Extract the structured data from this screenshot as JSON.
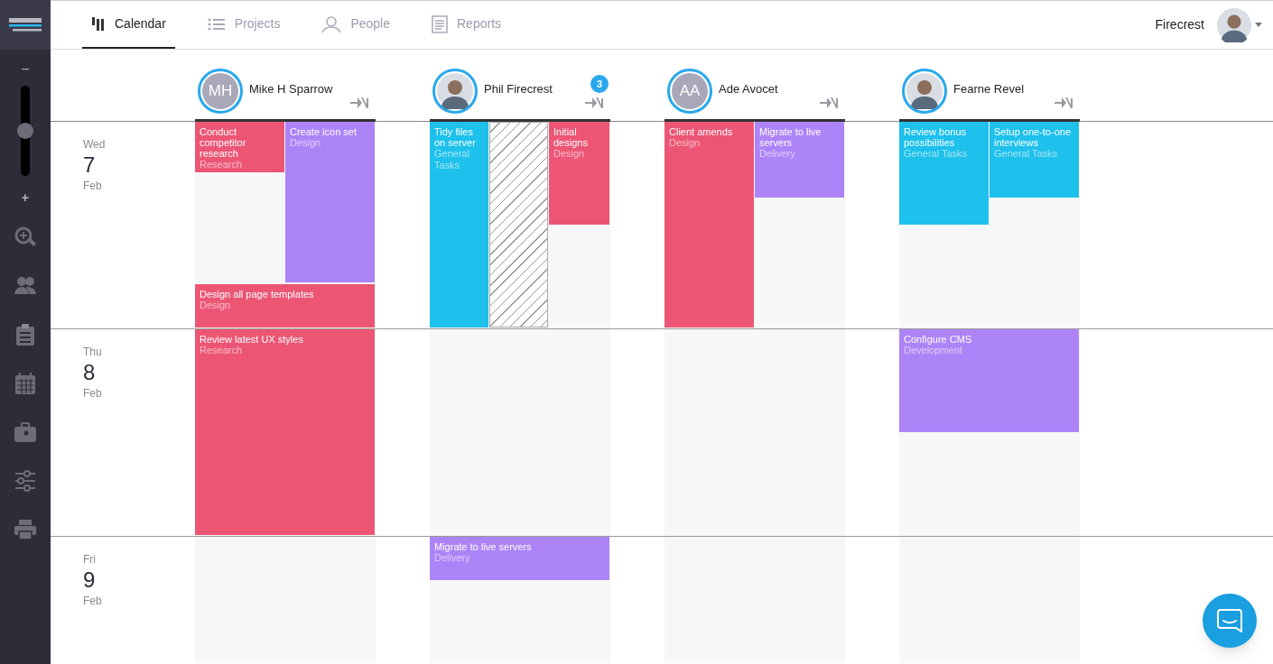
{
  "nav": {
    "tabs": [
      {
        "label": "Calendar",
        "kind": "calendar",
        "selected": true
      },
      {
        "label": "Projects",
        "kind": "projects",
        "selected": false
      },
      {
        "label": "People",
        "kind": "people",
        "selected": false
      },
      {
        "label": "Reports",
        "kind": "reports",
        "selected": false
      }
    ],
    "account": {
      "name": "Firecrest"
    }
  },
  "sidebar": {
    "zoom_out": "−",
    "zoom_in": "+",
    "zoom": {
      "level": 0.5
    }
  },
  "people": [
    {
      "name": "Mike H Sparrow",
      "kind": "initials",
      "initials": "MH"
    },
    {
      "name": "Phil Firecrest",
      "kind": "photo",
      "badge": "3"
    },
    {
      "name": "Ade Avocet",
      "kind": "initials",
      "initials": "AA"
    },
    {
      "name": "Fearne Revel",
      "kind": "photo"
    }
  ],
  "days": [
    {
      "weekday": "Wed",
      "day": "7",
      "month": "Feb",
      "cells": [
        [
          {
            "kind": "task",
            "title": "Conduct competitor research",
            "category": "Research",
            "color": "#ec5674"
          },
          {
            "kind": "task",
            "title": "Create icon set",
            "category": "Design",
            "color": "#ad84f8"
          },
          {
            "kind": "task",
            "title": "Design all page templates",
            "category": "Design",
            "color": "#ec5674"
          }
        ],
        [
          {
            "kind": "task",
            "title": "Tidy files on server",
            "category": "General Tasks",
            "color": "#1ec0ec"
          },
          {
            "kind": "blocked"
          },
          {
            "kind": "task",
            "title": "Initial designs",
            "category": "Design",
            "color": "#ec5674"
          }
        ],
        [
          {
            "kind": "task",
            "title": "Client amends",
            "category": "Design",
            "color": "#ec5674"
          },
          {
            "kind": "task",
            "title": "Migrate to live servers",
            "category": "Delivery",
            "color": "#ad84f8"
          }
        ],
        [
          {
            "kind": "task",
            "title": "Review bonus possibilities",
            "category": "General Tasks",
            "color": "#1ec0ec"
          },
          {
            "kind": "task",
            "title": "Setup one-to-one interviews",
            "category": "General Tasks",
            "color": "#1ec0ec"
          }
        ]
      ]
    },
    {
      "weekday": "Thu",
      "day": "8",
      "month": "Feb",
      "cells": [
        [
          {
            "kind": "task",
            "title": "Review latest UX styles",
            "category": "Research",
            "color": "#ec5674"
          }
        ],
        [],
        [],
        [
          {
            "kind": "task",
            "title": "Configure CMS",
            "category": "Development",
            "color": "#ad84f8"
          }
        ]
      ]
    },
    {
      "weekday": "Fri",
      "day": "9",
      "month": "Feb",
      "cells": [
        [],
        [
          {
            "kind": "task",
            "title": "Migrate to live servers",
            "category": "Delivery",
            "color": "#ad84f8"
          }
        ],
        [],
        []
      ]
    }
  ]
}
